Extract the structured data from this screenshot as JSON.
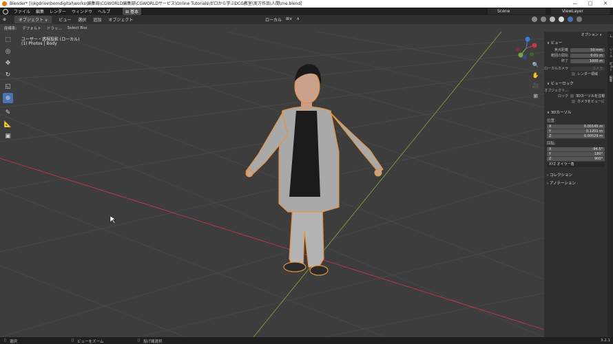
{
  "window": {
    "title": "Blender* [\\\\kgdrive\\bomdigital\\works\\編集局\\CGWORLD編集部\\CGWORLDサービス\\Online Tutorials\\ゼロから学ぶDCG教室\\実方作品\\人間\\me.blend]",
    "controls": {
      "minimize": "—",
      "maximize": "□",
      "close": "✕"
    }
  },
  "menubar": {
    "items": [
      "ファイル",
      "編集",
      "レンダー",
      "ウィンドウ",
      "ヘルプ"
    ],
    "workspace": "⊞ 基本",
    "scene": "Scene",
    "view_layer": "ViewLayer"
  },
  "header": {
    "editor_type": "⊕",
    "mode": "オブジェクト ∨",
    "menus": [
      "ビュー",
      "選択",
      "追加",
      "オブジェクト"
    ],
    "transform_orientation": "ローカル",
    "snap": "⊞∨",
    "proportional": "∧"
  },
  "toolrow": {
    "orientation_label": "座標系:",
    "orientation_value": "デフォルト",
    "drag_label": "ドラッ...",
    "drag_value": "Select Box"
  },
  "viewport": {
    "view_name": "ユーザー・透視投影 (ローカル)",
    "object_info": "(1) Photos | Body"
  },
  "sidebar": {
    "options": "オプション ∨",
    "view_panel": {
      "title": "∨ ビュー",
      "focal_label": "焦点距離",
      "focal_value": "50 mm",
      "clip_start_label": "範囲の開始",
      "clip_start_value": "0.01 m",
      "clip_end_label": "終了",
      "clip_end_value": "1000 m",
      "local_camera_label": "ローカルカメラ",
      "local_camera_value": "カメラ",
      "render_region": "レンダー領域"
    },
    "view_lock": {
      "title": "∨ ビューロック",
      "object_label": "オブジェクト...",
      "lock_label": "ロック",
      "to_3d_cursor": "3Dカーソルを注視",
      "camera_to_view": "カメラをビューに"
    },
    "cursor_panel": {
      "title": "∨ 3Dカーソル",
      "location_label": "位置:",
      "location": [
        {
          "axis": "X",
          "value": "0.00145 m"
        },
        {
          "axis": "Y",
          "value": "0.1201 m"
        },
        {
          "axis": "Z",
          "value": "0.00529 m"
        }
      ],
      "rotation_label": "回転:",
      "rotation": [
        {
          "axis": "X",
          "value": "-94.5°"
        },
        {
          "axis": "Y",
          "value": "180°"
        },
        {
          "axis": "Z",
          "value": "900°"
        }
      ],
      "rotation_mode": "XYZ オイラー角"
    },
    "collection": "› コレクション",
    "annotation": "› アノテーション",
    "tabs": [
      "アイテム",
      "ツール",
      "ビュー",
      "編集"
    ]
  },
  "statusbar": {
    "select": "選択",
    "zoom": "ビューをズーム",
    "lasso": "投げ縄選択",
    "version": "3.2.1"
  },
  "colors": {
    "accent": "#4772b3",
    "outline": "#e8903d",
    "axis_x": "#c0394a",
    "axis_y": "#7ba53a"
  }
}
